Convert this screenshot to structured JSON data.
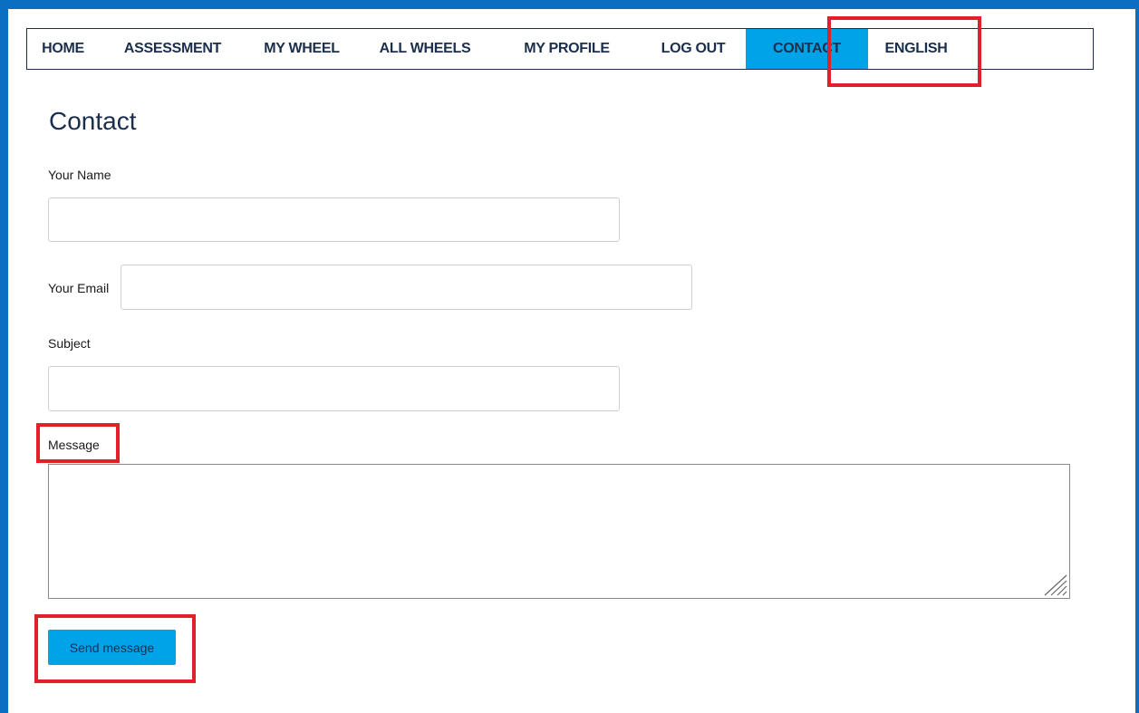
{
  "nav": {
    "items": [
      {
        "label": "HOME",
        "active": false
      },
      {
        "label": "ASSESSMENT",
        "active": false
      },
      {
        "label": "MY WHEEL",
        "active": false
      },
      {
        "label": "ALL WHEELS",
        "active": false
      },
      {
        "label": "MY PROFILE",
        "active": false
      },
      {
        "label": "LOG OUT",
        "active": false
      },
      {
        "label": "CONTACT",
        "active": true
      },
      {
        "label": "ENGLISH",
        "active": false
      }
    ]
  },
  "page": {
    "title": "Contact"
  },
  "form": {
    "name_label": "Your Name",
    "name_value": "",
    "email_label": "Your Email",
    "email_value": "",
    "subject_label": "Subject",
    "subject_value": "",
    "message_label": "Message",
    "message_value": "",
    "submit_label": "Send message"
  },
  "colors": {
    "accent": "#00a3e8",
    "frame": "#0a6fc2",
    "nav_text": "#1b2f4d",
    "highlight": "#e3202a"
  },
  "icons": {
    "resize": "resize-grip-icon"
  }
}
